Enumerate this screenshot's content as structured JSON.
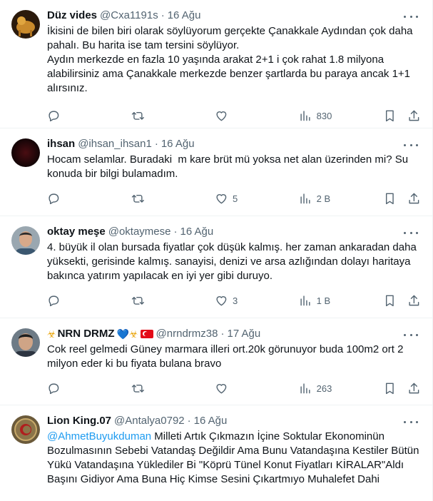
{
  "tweets": [
    {
      "name": "Düz vides",
      "handle": "@Cxa1191s",
      "time": "16 Ağu",
      "text": "İkisini de bilen biri olarak söylüyorum gerçekte Çanakkale Aydından çok daha pahalı. Bu harita ise tam tersini söylüyor.\nAydın merkezde en fazla 10 yaşında arakat 2+1 i çok rahat 1.8 milyona alabilirsiniz ama Çanakkale merkezde benzer şartlarda bu paraya ancak 1+1 alırsınız.",
      "reply_count": "",
      "retweet_count": "",
      "like_count": "",
      "view_count": "830"
    },
    {
      "name": "ihsan",
      "handle": "@ihsan_ihsan1",
      "time": "16 Ağu",
      "text": "Hocam selamlar. Buradaki  m kare brüt mü yoksa net alan üzerinden mi? Su konuda bir bilgi bulamadım.",
      "reply_count": "",
      "retweet_count": "",
      "like_count": "5",
      "view_count": "2 B"
    },
    {
      "name": "oktay meşe",
      "handle": "@oktaymese",
      "time": "16 Ağu",
      "text": "4. büyük il olan bursada fiyatlar çok düşük kalmış. her zaman ankaradan daha yüksekti, gerisinde kalmış. sanayisi, denizi ve arsa azlığından dolayı haritaya bakınca yatırım yapılacak en iyi yer gibi duruyo.",
      "reply_count": "",
      "retweet_count": "",
      "like_count": "3",
      "view_count": "1 B"
    },
    {
      "name": "NRN DRMZ",
      "name_prefix": "☣",
      "name_suffix": "💙☣",
      "handle": "@nrndrmz38",
      "time": "17 Ağu",
      "text": "Cok reel gelmedi Güney marmara illeri ort.20k görunuyor buda 100m2 ort 2 milyon eder ki bu fiyata bulana bravo",
      "reply_count": "",
      "retweet_count": "",
      "like_count": "",
      "view_count": "263"
    },
    {
      "name": "Lion King.07",
      "handle": "@Antalya0792",
      "time": "16 Ağu",
      "mention": "@AhmetBuyukduman",
      "text": " Milleti Artık Çıkmazın İçine Soktular Ekonominün Bozulmasının Sebebi Vatandaş Değildir Ama Bunu Vatandaşına Kestiler Bütün Yükü Vatandaşına Yüklediler Bi \"Köprü Tünel Konut Fiyatları KİRALAR\"Aldı Başını Gidiyor Ama Buna Hiç Kimse Sesini Çıkartmıyo Muhalefet Dahi"
    }
  ],
  "colors": {
    "text": "#0f1419",
    "muted": "#536471",
    "link": "#1d9bf0",
    "border": "#eff3f4"
  },
  "icons": {
    "reply": "reply-icon",
    "retweet": "retweet-icon",
    "like": "heart-icon",
    "views": "views-icon",
    "bookmark": "bookmark-icon",
    "share": "share-icon",
    "more": "more-icon"
  }
}
